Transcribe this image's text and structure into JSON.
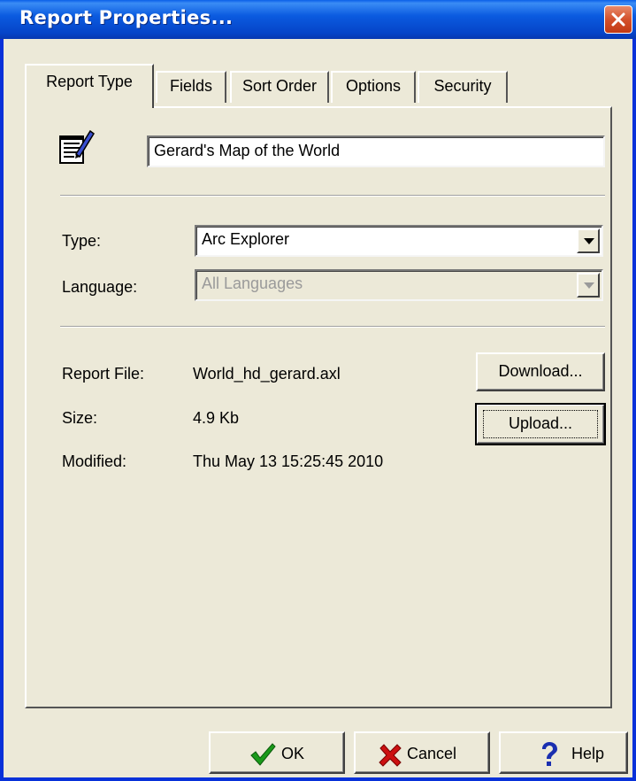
{
  "window": {
    "title": "Report Properties..."
  },
  "tabs": [
    {
      "label": "Report Type",
      "active": true
    },
    {
      "label": "Fields"
    },
    {
      "label": "Sort Order"
    },
    {
      "label": "Options"
    },
    {
      "label": "Security"
    }
  ],
  "report": {
    "name": "Gerard's Map of the World",
    "type_label": "Type:",
    "type_value": "Arc Explorer",
    "language_label": "Language:",
    "language_value": "All Languages",
    "file_label": "Report File:",
    "file_value": "World_hd_gerard.axl",
    "size_label": "Size:",
    "size_value": "4.9 Kb",
    "modified_label": "Modified:",
    "modified_value": "Thu May 13 15:25:45 2010"
  },
  "buttons": {
    "download": "Download...",
    "upload": "Upload...",
    "ok": "OK",
    "cancel": "Cancel",
    "help": "Help"
  },
  "colors": {
    "titlebar": "#0544c8",
    "face": "#ece9d8",
    "ok_check": "#1a9a1a",
    "cancel_x": "#cc1111",
    "help_q": "#1a2fb0"
  },
  "icons": [
    "close-icon",
    "report-document-icon",
    "dropdown-arrow-icon",
    "checkmark-icon",
    "x-mark-icon",
    "question-mark-icon"
  ]
}
